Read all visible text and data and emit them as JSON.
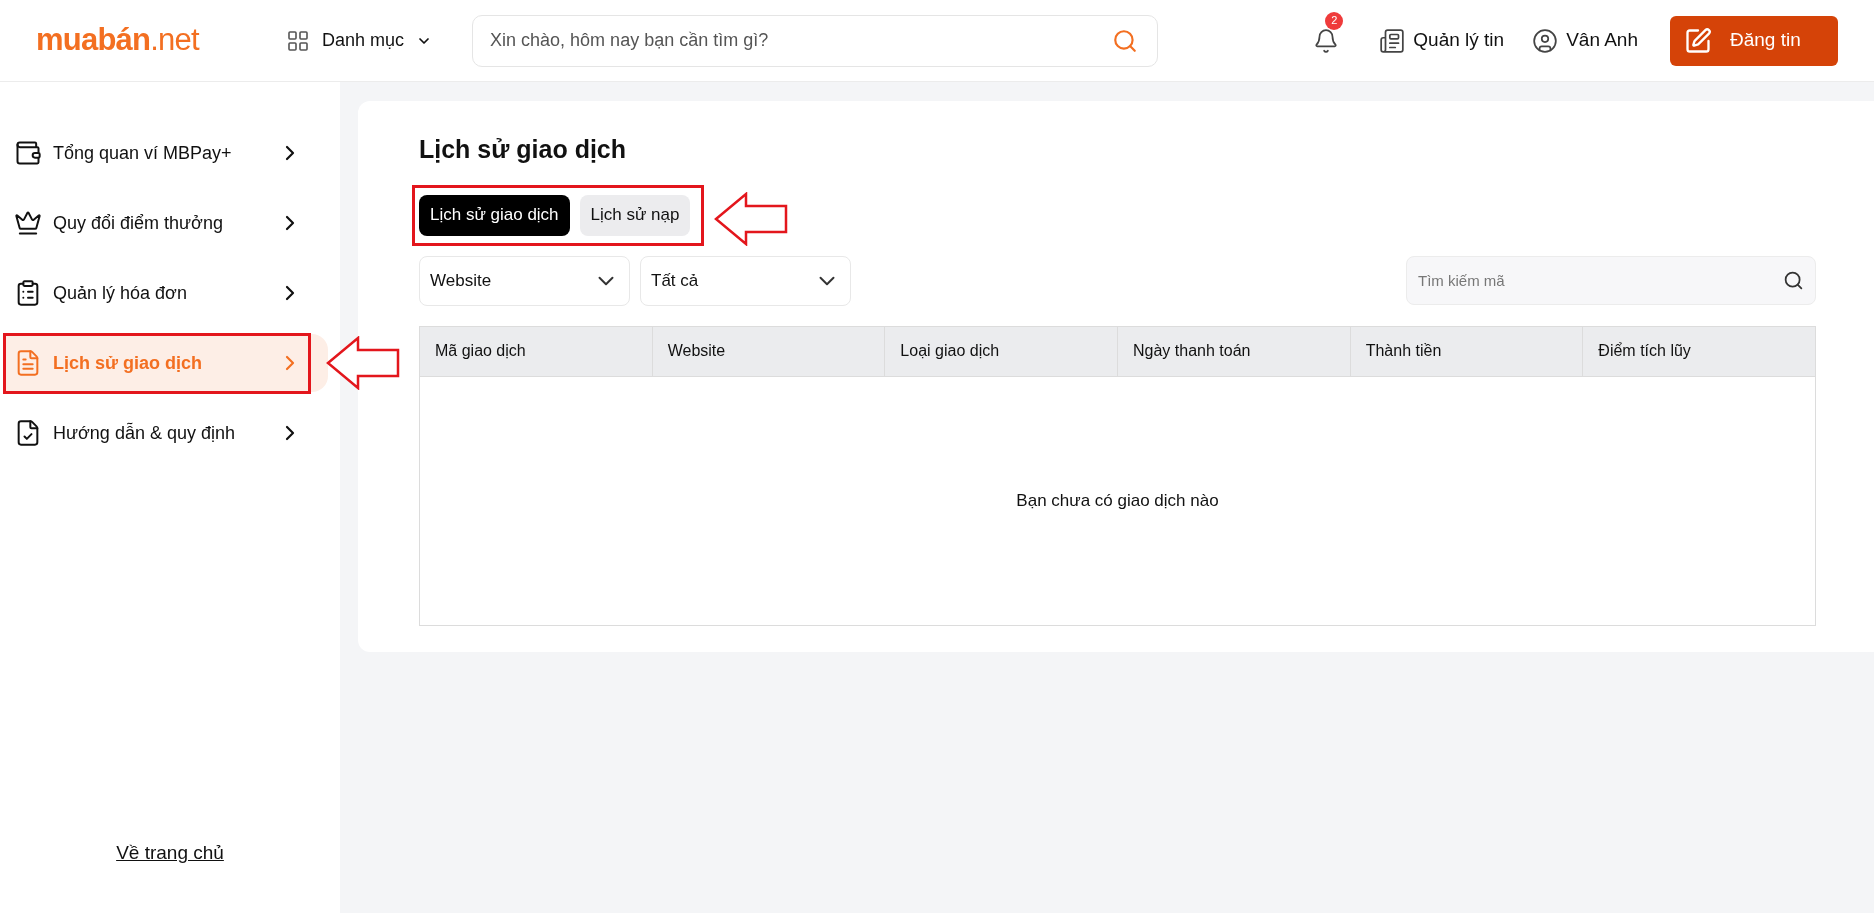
{
  "header": {
    "logo": {
      "main": "muabán",
      "suffix": ".net"
    },
    "category_menu": "Danh mục",
    "search": {
      "placeholder": "Xin chào, hôm nay bạn cần tìm gì?"
    },
    "notification_count": "2",
    "manage_posts": "Quản lý tin",
    "user": "Vân Anh",
    "post_button": "Đăng tin"
  },
  "sidebar": {
    "items": [
      {
        "label": "Tổng quan ví MBPay+",
        "selected": false
      },
      {
        "label": "Quy đổi điểm thưởng",
        "selected": false
      },
      {
        "label": "Quản lý hóa đơn",
        "selected": false
      },
      {
        "label": "Lịch sử giao dịch",
        "selected": true
      },
      {
        "label": "Hướng dẫn & quy định",
        "selected": false
      }
    ],
    "home_link": "Về trang chủ"
  },
  "main": {
    "title": "Lịch sử giao dịch",
    "tabs": [
      {
        "label": "Lịch sử giao dịch",
        "selected": true
      },
      {
        "label": "Lịch sử nạp",
        "selected": false
      }
    ],
    "filters": [
      {
        "value": "Website"
      },
      {
        "value": "Tất cả"
      }
    ],
    "search": {
      "placeholder": "Tìm kiếm mã"
    },
    "table": {
      "columns": [
        "Mã giao dịch",
        "Website",
        "Loại giao dịch",
        "Ngày thanh toán",
        "Thành tiền",
        "Điểm tích lũy"
      ],
      "empty_message": "Bạn chưa có giao dịch nào"
    }
  }
}
